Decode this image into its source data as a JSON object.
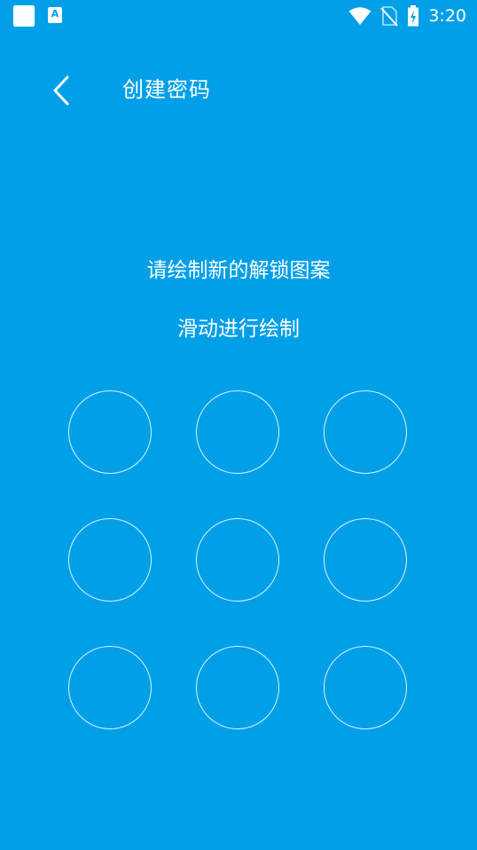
{
  "status_bar": {
    "notification_icons": [
      "square-notification-icon",
      "a-notification-icon"
    ],
    "a_glyph": "A",
    "system_icons": [
      "wifi-icon",
      "no-sim-icon",
      "battery-charging-icon"
    ],
    "time": "3:20"
  },
  "header": {
    "back_icon": "chevron-left-icon",
    "title": "创建密码"
  },
  "prompt": {
    "main": "请绘制新的解锁图案",
    "sub": "滑动进行绘制"
  },
  "pattern": {
    "rows": 3,
    "cols": 3,
    "dot_color": "#ffffff"
  },
  "colors": {
    "background": "#009fe8",
    "foreground": "#ffffff"
  }
}
